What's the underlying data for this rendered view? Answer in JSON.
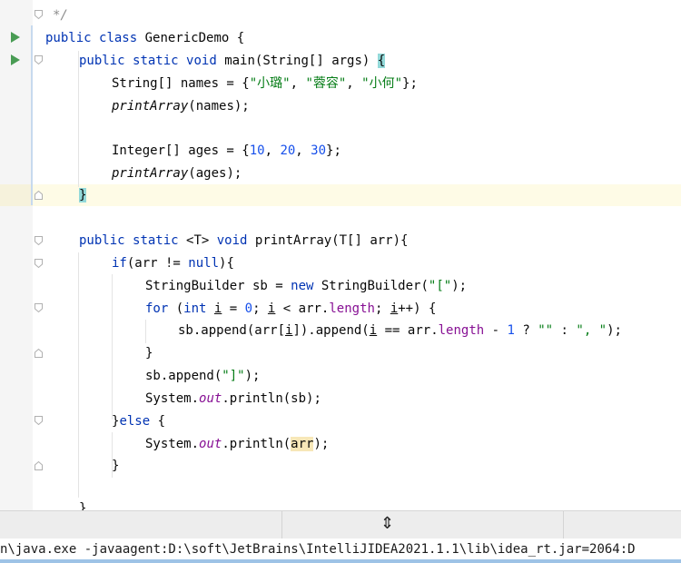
{
  "editor": {
    "lines": {
      "l0": {
        "comment": "*/"
      },
      "l1": {
        "kw1": "public",
        "kw2": "class",
        "name": "GenericDemo",
        "brace": "{"
      },
      "l2": {
        "kw1": "public",
        "kw2": "static",
        "kw3": "void",
        "name": "main",
        "params": "(String[] args) ",
        "brace": "{"
      },
      "l3": {
        "decl": "String[] names = {",
        "s1": "\"小璐\"",
        "sep1": ", ",
        "s2": "\"蓉容\"",
        "sep2": ", ",
        "s3": "\"小何\"",
        "end": "};"
      },
      "l4": {
        "call": "printArray",
        "args": "(names);"
      },
      "l5": {
        "decl": "Integer[] ages = {",
        "n1": "10",
        "sep1": ", ",
        "n2": "20",
        "sep2": ", ",
        "n3": "30",
        "end": "};"
      },
      "l6": {
        "call": "printArray",
        "args": "(ages);"
      },
      "l7": {
        "brace": "}"
      },
      "l8": {
        "kw1": "public",
        "kw2": "static",
        "generic": " <T> ",
        "kw3": "void",
        "rest": " printArray(T[] arr){"
      },
      "l9": {
        "kw": "if",
        "pre": "(arr != ",
        "null": "null",
        "post": "){"
      },
      "l10": {
        "pre": "StringBuilder sb = ",
        "kw": "new",
        "mid": " StringBuilder(",
        "str": "\"[\"",
        "end": ");"
      },
      "l11": {
        "kw1": "for",
        "p1": " (",
        "kw2": "int",
        "sp": " ",
        "i1": "i",
        "eq": " = ",
        "n0": "0",
        "semi": "; ",
        "i2": "i",
        "lt": " < arr.",
        "len": "length",
        "semi2": "; ",
        "i3": "i",
        "inc": "++) {"
      },
      "l12": {
        "pre": "sb.append(arr[",
        "i1": "i",
        "mid": "]).append(",
        "i2": "i",
        "eq": " == arr.",
        "len": "length",
        "minus": " - ",
        "n1": "1",
        "q": " ? ",
        "s1": "\"\"",
        "colon": " : ",
        "s2": "\", \"",
        "end": ");"
      },
      "l13": {
        "brace": "}"
      },
      "l14": {
        "pre": "sb.append(",
        "str": "\"]\"",
        "end": ");"
      },
      "l15": {
        "pre": "System.",
        "out": "out",
        "post": ".println(sb);"
      },
      "l16": {
        "close": "}",
        "kw": "else",
        "post": " {"
      },
      "l17": {
        "pre": "System.",
        "out": "out",
        "mid": ".println(",
        "var": "arr",
        "end": ");"
      },
      "l18": {
        "brace": "}"
      },
      "l19": {
        "brace": "}"
      }
    }
  },
  "console": {
    "text": "n\\java.exe -javaagent:D:\\soft\\JetBrains\\IntelliJIDEA2021.1.1\\lib\\idea_rt.jar=2064:D"
  },
  "colors": {
    "keyword": "#0033b3",
    "string": "#067d17",
    "number": "#1750eb",
    "field": "#871094",
    "run_icon": "#499c54",
    "current_line": "#fefbe6",
    "brace_match": "#93d9d9"
  },
  "icons": [
    "run-icon",
    "fold-icon",
    "resize-vertical-icon"
  ]
}
